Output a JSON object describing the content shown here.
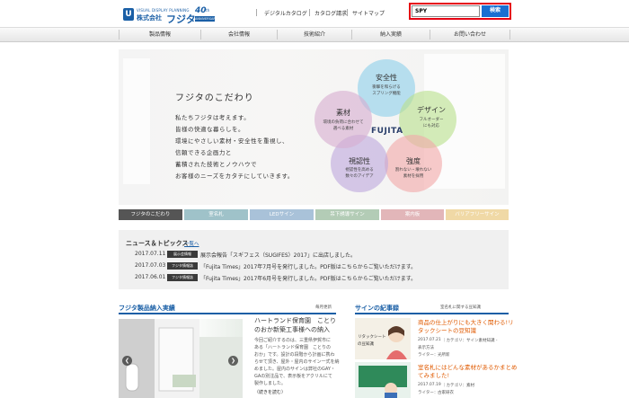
{
  "header": {
    "logo": {
      "tagline": "VISUAL DISPLAY PLANNING",
      "company_prefix": "株式会社",
      "company_name": "フジタ",
      "anniv_number": "40",
      "anniv_suffix": "th",
      "anniv_text": "ANNIVERSARY"
    },
    "util_links": [
      "デジタルカタログ",
      "カタログ請求",
      "サイトマップ"
    ],
    "search": {
      "value": "SPY",
      "button": "検索"
    }
  },
  "gnav": [
    "製品情報",
    "会社情報",
    "技術紹介",
    "納入実績",
    "お問い合わせ"
  ],
  "hero": {
    "title": "フジタのこだわり",
    "lines": [
      "私たちフジタは考えます。",
      "皆様の快適な暮らしを。",
      "環境にやさしい素材・安全性を重視し、",
      "信頼できる企画力と",
      "蓄積された技術とノウハウで",
      "お客様のニーズをカタチにしていきます。"
    ],
    "center": "FUJITA",
    "circles": [
      {
        "title": "安全性",
        "sub": [
          "衝撃を和らげる",
          "スプリング機能"
        ],
        "color": "#8fd0ea"
      },
      {
        "title": "デザイン",
        "sub": [
          "フルオーダー",
          "にも対応"
        ],
        "color": "#b9e08e"
      },
      {
        "title": "強度",
        "sub": [
          "割れない・壊れない",
          "素材を採用"
        ],
        "color": "#f2a9a9"
      },
      {
        "title": "視認性",
        "sub": [
          "視認性を高める",
          "数々のアイデア"
        ],
        "color": "#bfa9dd"
      },
      {
        "title": "素材",
        "sub": [
          "環境の負荷に合わせて",
          "選べる素材"
        ],
        "color": "#d7aed0"
      }
    ]
  },
  "tabs": [
    {
      "label": "フジタのこだわり",
      "color": "#555555"
    },
    {
      "label": "室名札",
      "color": "#9fc2c9"
    },
    {
      "label": "LEDサイン",
      "color": "#a9c2d9"
    },
    {
      "label": "吊下誘導サイン",
      "color": "#b3ccb6"
    },
    {
      "label": "案内板",
      "color": "#e2b6b9"
    },
    {
      "label": "バリアフリーサイン",
      "color": "#f0d9a6"
    }
  ],
  "news": {
    "title": "ニュース＆トピックス",
    "more": "一覧へ",
    "items": [
      {
        "date": "2017.07.11",
        "badge": "展示会情報",
        "text": "展示会報告「スギフェス（SUGIFES）2017」に出店しました。"
      },
      {
        "date": "2017.07.03",
        "badge": "フジタ情報誌",
        "text": "「Fujita Times」2017年7月号を発行しました。PDF版はこちらからご覧いただけます。"
      },
      {
        "date": "2017.06.01",
        "badge": "フジタ情報誌",
        "text": "「Fujita Times」2017年6月号を発行しました。PDF版はこちらからご覧いただけます。"
      }
    ]
  },
  "works": {
    "title": "フジタ製品納入実績",
    "link": "毎月更新",
    "item_title": [
      "ハートランド保育園　ことり",
      "のおか新築工事様への納入"
    ],
    "item_desc": [
      "今回ご紹介するのは、三重県伊賀市に",
      "ある「ハートランド保育園　ことりの",
      "おか」です。設計の段階から計画に携わ",
      "らせて頂き、屋外・屋内のサイン一式を納",
      "めました。屋内のサインは弊社のGAY・",
      "GAの別注品で、表示板をアクリルにて",
      "製作しました。"
    ],
    "more": "（続きを読む）"
  },
  "articles": {
    "title": "サインの紀事録",
    "link": "室名札に関する豆知識",
    "thumb_caption": [
      "リタックシート",
      "の豆知識"
    ],
    "items": [
      {
        "title": [
          "商品の仕上がりにも大きく関わる!リ",
          "タックシートの豆知識"
        ],
        "date": "2017.07.21",
        "meta": "｜カテゴリ：サイン素材知識 -",
        "extra": "表示方法",
        "writer": "ライター：",
        "writer_name": "光所新"
      },
      {
        "title": [
          "室名札にはどんな素材があるかまとめ",
          "てみました!"
        ],
        "date": "2017.07.19",
        "meta": "｜カテゴリ：素材",
        "extra": "",
        "writer": "ライター：",
        "writer_name": "古家研衣"
      }
    ]
  }
}
